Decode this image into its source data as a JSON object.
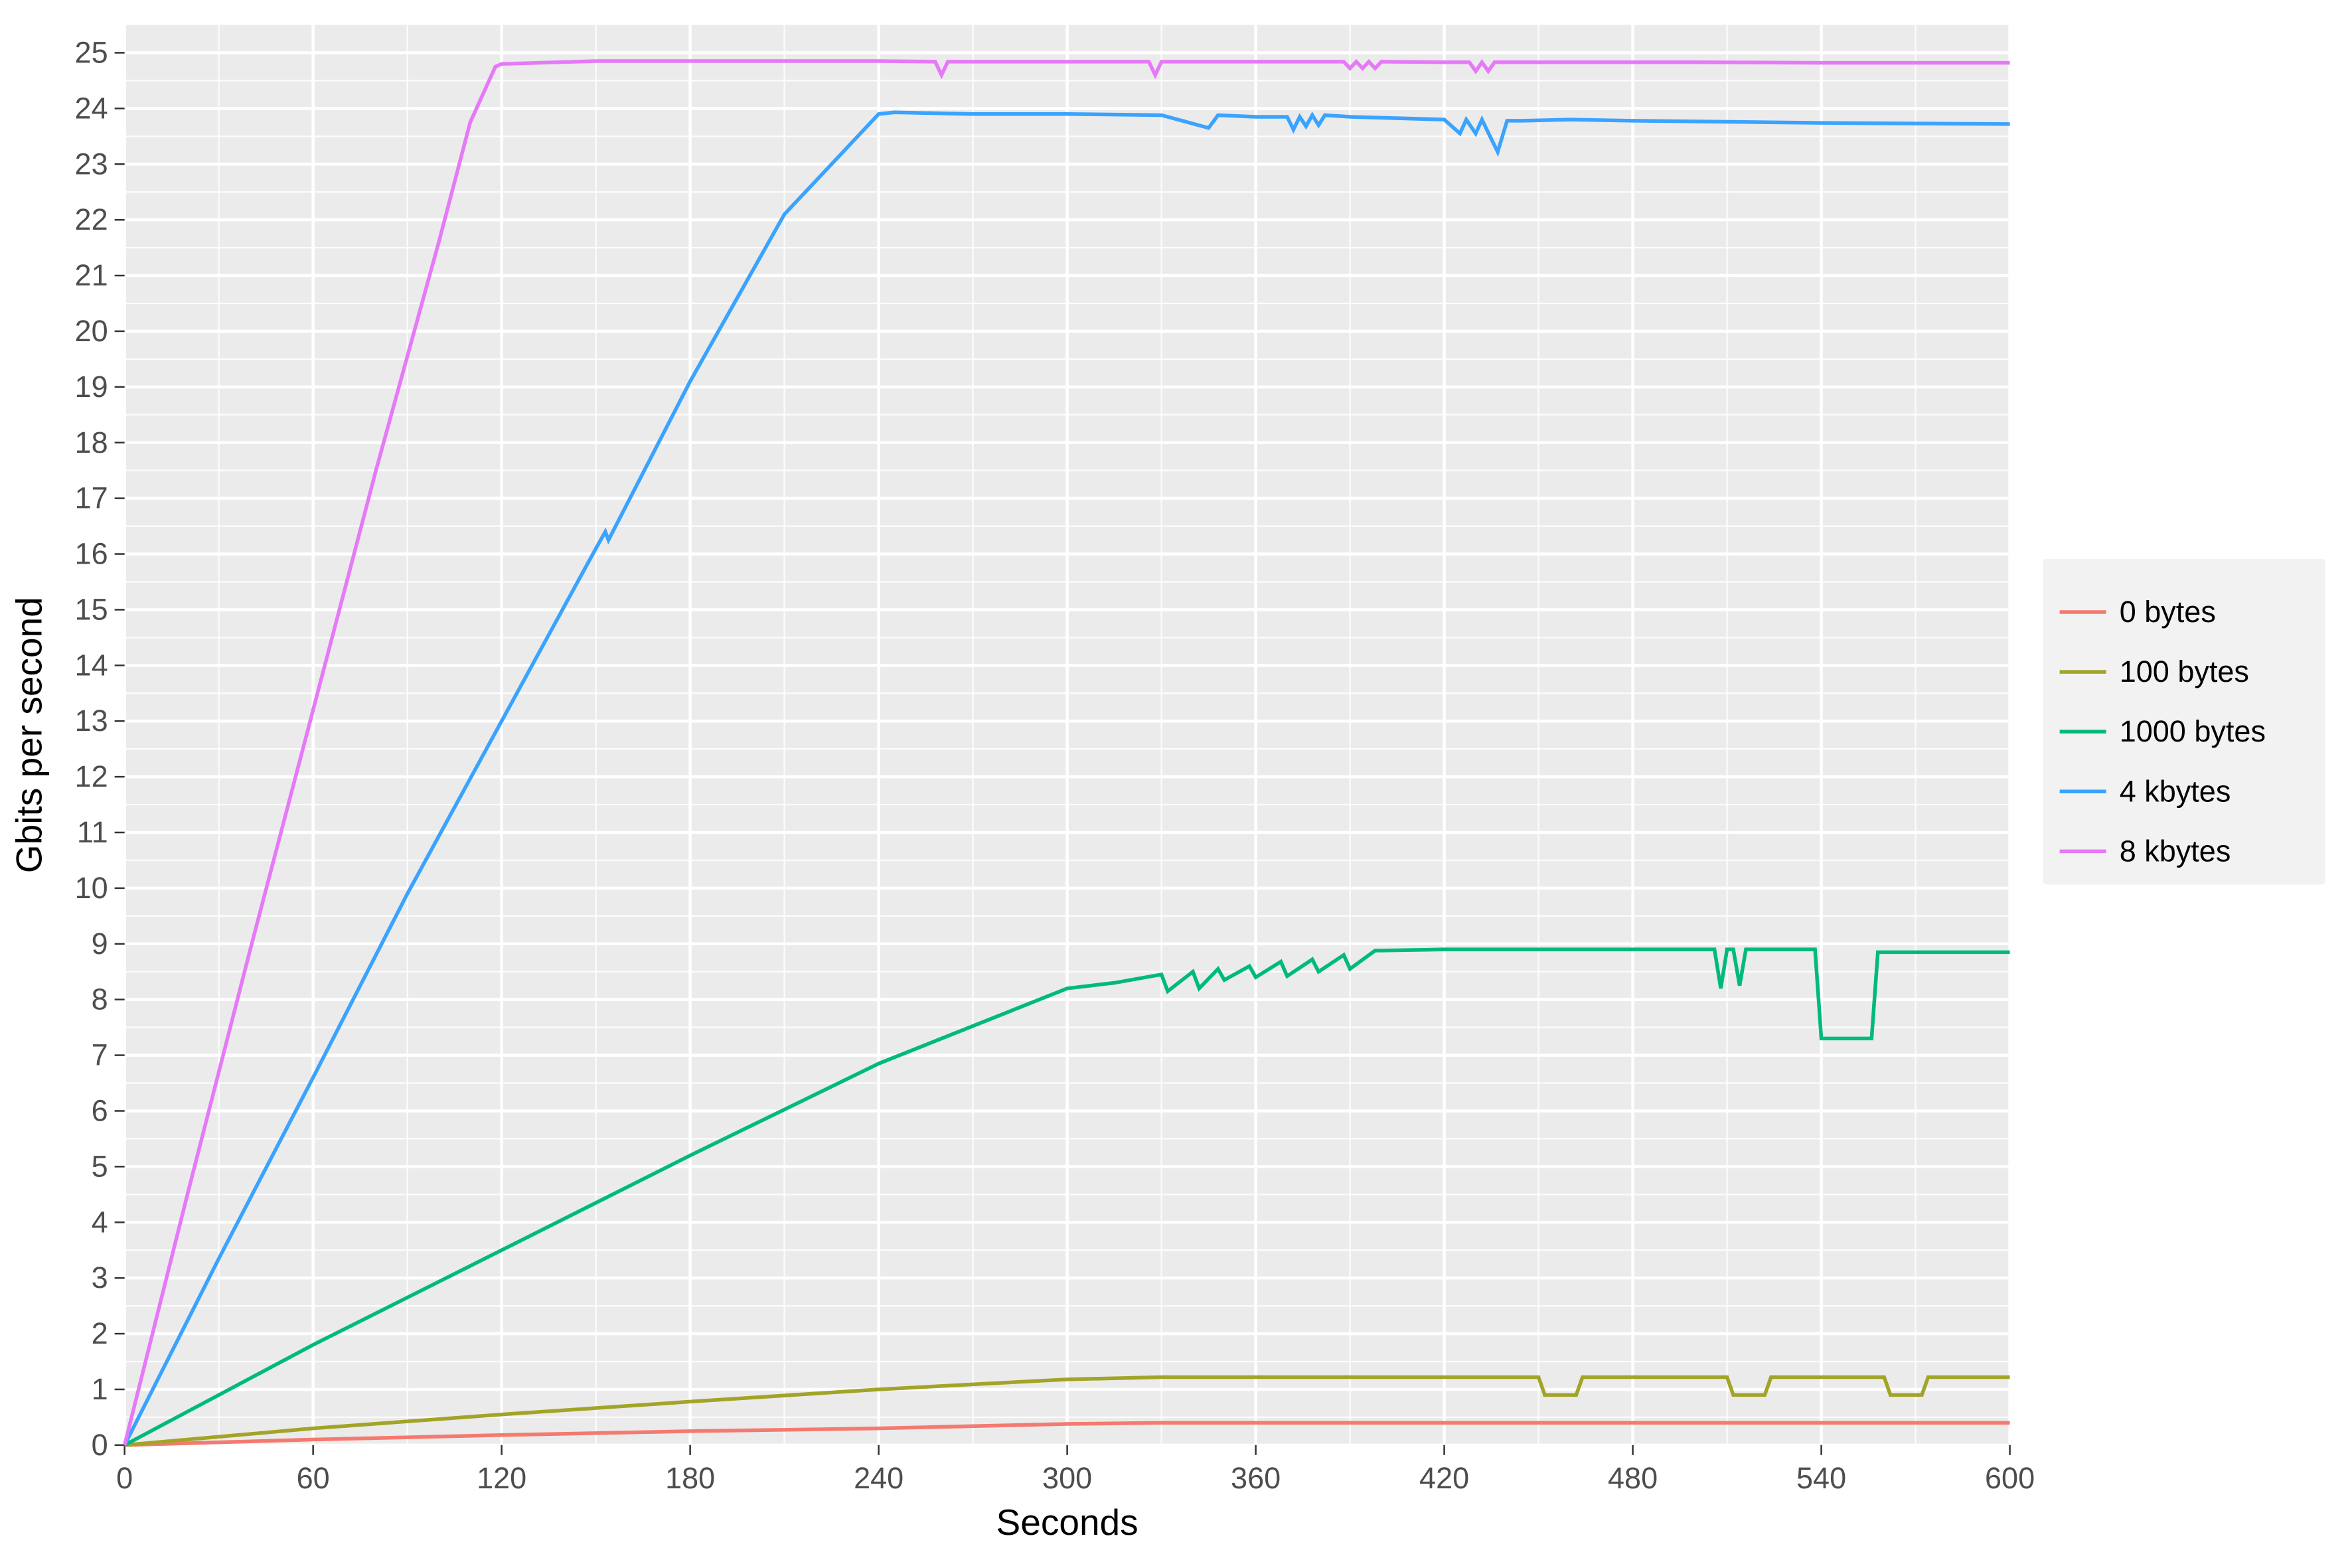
{
  "chart_data": {
    "type": "line",
    "xlabel": "Seconds",
    "ylabel": "Gbits per second",
    "xlim": [
      0,
      600
    ],
    "ylim": [
      0,
      25.5
    ],
    "x_ticks": [
      0,
      60,
      120,
      180,
      240,
      300,
      360,
      420,
      480,
      540,
      600
    ],
    "y_ticks": [
      0,
      1,
      2,
      3,
      4,
      5,
      6,
      7,
      8,
      9,
      10,
      11,
      12,
      13,
      14,
      15,
      16,
      17,
      18,
      19,
      20,
      21,
      22,
      23,
      24,
      25
    ],
    "grid": true,
    "legend_position": "right",
    "series": [
      {
        "name": "0 bytes",
        "color": "#f47a6f",
        "values": [
          [
            0,
            0
          ],
          [
            60,
            0.1
          ],
          [
            120,
            0.18
          ],
          [
            180,
            0.25
          ],
          [
            240,
            0.3
          ],
          [
            300,
            0.38
          ],
          [
            330,
            0.4
          ],
          [
            360,
            0.4
          ],
          [
            420,
            0.4
          ],
          [
            480,
            0.4
          ],
          [
            540,
            0.4
          ],
          [
            600,
            0.4
          ]
        ]
      },
      {
        "name": "100 bytes",
        "color": "#a2a428",
        "values": [
          [
            0,
            0
          ],
          [
            60,
            0.3
          ],
          [
            120,
            0.55
          ],
          [
            180,
            0.78
          ],
          [
            240,
            1.0
          ],
          [
            300,
            1.18
          ],
          [
            330,
            1.22
          ],
          [
            360,
            1.22
          ],
          [
            420,
            1.22
          ],
          [
            450,
            1.22
          ],
          [
            452,
            0.9
          ],
          [
            462,
            0.9
          ],
          [
            464,
            1.22
          ],
          [
            480,
            1.22
          ],
          [
            510,
            1.22
          ],
          [
            512,
            0.9
          ],
          [
            522,
            0.9
          ],
          [
            524,
            1.22
          ],
          [
            540,
            1.22
          ],
          [
            560,
            1.22
          ],
          [
            562,
            0.9
          ],
          [
            572,
            0.9
          ],
          [
            574,
            1.22
          ],
          [
            600,
            1.22
          ]
        ]
      },
      {
        "name": "1000 bytes",
        "color": "#00ba7d",
        "values": [
          [
            0,
            0
          ],
          [
            60,
            1.8
          ],
          [
            120,
            3.5
          ],
          [
            180,
            5.2
          ],
          [
            240,
            6.85
          ],
          [
            300,
            8.2
          ],
          [
            315,
            8.3
          ],
          [
            330,
            8.45
          ],
          [
            332,
            8.15
          ],
          [
            340,
            8.5
          ],
          [
            342,
            8.2
          ],
          [
            348,
            8.55
          ],
          [
            350,
            8.35
          ],
          [
            358,
            8.6
          ],
          [
            360,
            8.4
          ],
          [
            368,
            8.68
          ],
          [
            370,
            8.42
          ],
          [
            378,
            8.72
          ],
          [
            380,
            8.5
          ],
          [
            388,
            8.8
          ],
          [
            390,
            8.55
          ],
          [
            398,
            8.88
          ],
          [
            400,
            8.88
          ],
          [
            420,
            8.9
          ],
          [
            480,
            8.9
          ],
          [
            506,
            8.9
          ],
          [
            508,
            8.2
          ],
          [
            510,
            8.9
          ],
          [
            512,
            8.9
          ],
          [
            514,
            8.25
          ],
          [
            516,
            8.9
          ],
          [
            538,
            8.9
          ],
          [
            540,
            7.3
          ],
          [
            556,
            7.3
          ],
          [
            558,
            8.85
          ],
          [
            600,
            8.85
          ]
        ]
      },
      {
        "name": "4 kbytes",
        "color": "#3aa3ff",
        "values": [
          [
            0,
            0
          ],
          [
            30,
            3.35
          ],
          [
            60,
            6.6
          ],
          [
            90,
            9.9
          ],
          [
            120,
            13.0
          ],
          [
            150,
            16.1
          ],
          [
            153,
            16.4
          ],
          [
            154,
            16.25
          ],
          [
            180,
            19.1
          ],
          [
            210,
            22.1
          ],
          [
            240,
            23.9
          ],
          [
            245,
            23.93
          ],
          [
            270,
            23.9
          ],
          [
            300,
            23.9
          ],
          [
            330,
            23.88
          ],
          [
            345,
            23.65
          ],
          [
            348,
            23.88
          ],
          [
            360,
            23.85
          ],
          [
            370,
            23.85
          ],
          [
            372,
            23.62
          ],
          [
            374,
            23.85
          ],
          [
            376,
            23.68
          ],
          [
            378,
            23.88
          ],
          [
            380,
            23.7
          ],
          [
            382,
            23.88
          ],
          [
            390,
            23.85
          ],
          [
            420,
            23.8
          ],
          [
            425,
            23.55
          ],
          [
            427,
            23.8
          ],
          [
            430,
            23.55
          ],
          [
            432,
            23.8
          ],
          [
            435,
            23.45
          ],
          [
            437,
            23.22
          ],
          [
            440,
            23.78
          ],
          [
            445,
            23.78
          ],
          [
            460,
            23.8
          ],
          [
            480,
            23.78
          ],
          [
            540,
            23.74
          ],
          [
            600,
            23.72
          ]
        ]
      },
      {
        "name": "8 kbytes",
        "color": "#e679f8",
        "values": [
          [
            0,
            0
          ],
          [
            20,
            4.5
          ],
          [
            40,
            8.9
          ],
          [
            60,
            13.2
          ],
          [
            80,
            17.5
          ],
          [
            100,
            21.6
          ],
          [
            110,
            23.75
          ],
          [
            118,
            24.75
          ],
          [
            120,
            24.8
          ],
          [
            150,
            24.85
          ],
          [
            240,
            24.85
          ],
          [
            258,
            24.84
          ],
          [
            260,
            24.6
          ],
          [
            262,
            24.84
          ],
          [
            300,
            24.84
          ],
          [
            326,
            24.84
          ],
          [
            328,
            24.6
          ],
          [
            330,
            24.84
          ],
          [
            360,
            24.84
          ],
          [
            388,
            24.84
          ],
          [
            390,
            24.72
          ],
          [
            392,
            24.84
          ],
          [
            394,
            24.72
          ],
          [
            396,
            24.84
          ],
          [
            398,
            24.72
          ],
          [
            400,
            24.84
          ],
          [
            420,
            24.83
          ],
          [
            428,
            24.83
          ],
          [
            430,
            24.67
          ],
          [
            432,
            24.83
          ],
          [
            434,
            24.67
          ],
          [
            436,
            24.83
          ],
          [
            500,
            24.83
          ],
          [
            540,
            24.82
          ],
          [
            600,
            24.82
          ]
        ]
      }
    ]
  }
}
